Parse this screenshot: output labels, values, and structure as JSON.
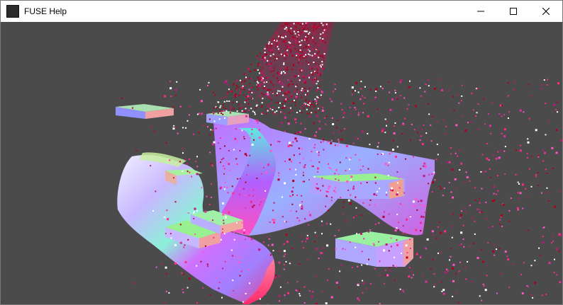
{
  "window": {
    "title": "FUSE Help",
    "controls": {
      "minimize_icon": "minimize-icon",
      "maximize_icon": "maximize-icon",
      "close_icon": "close-icon"
    }
  },
  "scene": {
    "background_color": "#4b4b4b",
    "particle_colors": [
      "#c0187a",
      "#e0309a",
      "#ff55c8",
      "#b00020",
      "#ffffff",
      "#ff2a8a"
    ]
  }
}
